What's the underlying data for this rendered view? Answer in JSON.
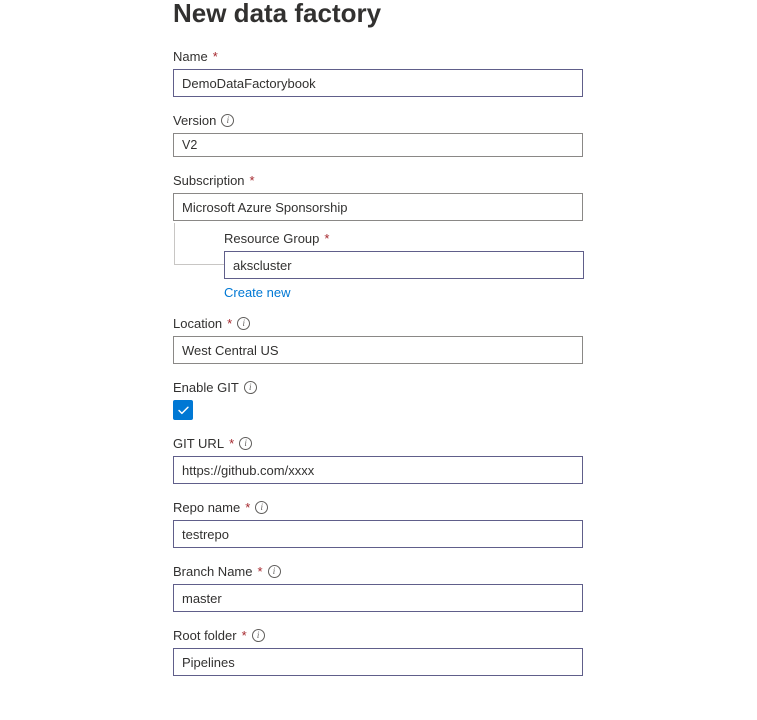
{
  "title": "New data factory",
  "fields": {
    "name": {
      "label": "Name",
      "value": "DemoDataFactorybook",
      "required": true
    },
    "version": {
      "label": "Version",
      "value": "V2",
      "info": true
    },
    "subscription": {
      "label": "Subscription",
      "value": "Microsoft Azure Sponsorship",
      "required": true
    },
    "resource_group": {
      "label": "Resource Group",
      "value": "akscluster",
      "required": true,
      "create_new": "Create new"
    },
    "location": {
      "label": "Location",
      "value": "West Central US",
      "required": true,
      "info": true
    },
    "enable_git": {
      "label": "Enable GIT",
      "info": true,
      "checked": true
    },
    "git_url": {
      "label": "GIT URL",
      "value": "https://github.com/xxxx",
      "required": true,
      "info": true
    },
    "repo_name": {
      "label": "Repo name",
      "value": "testrepo",
      "required": true,
      "info": true
    },
    "branch_name": {
      "label": "Branch Name",
      "value": "master",
      "required": true,
      "info": true
    },
    "root_folder": {
      "label": "Root folder",
      "value": "Pipelines",
      "required": true,
      "info": true
    }
  }
}
